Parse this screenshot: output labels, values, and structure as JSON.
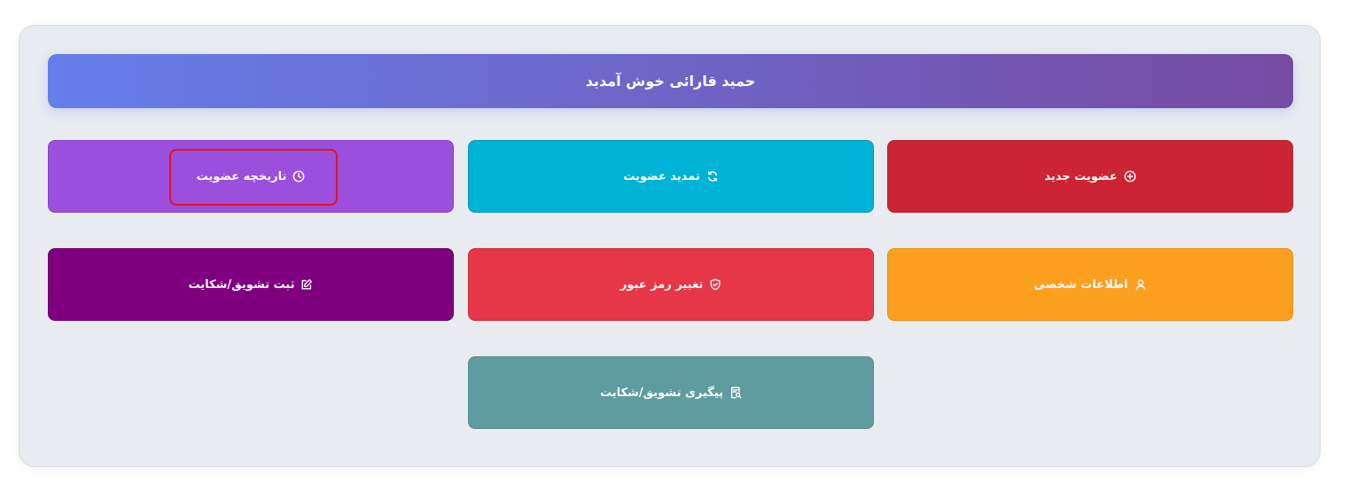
{
  "welcome": {
    "title": "حمید قارائی خوش آمدید"
  },
  "tiles": [
    {
      "label": "عضویت جدید",
      "icon": "plus-circle-icon",
      "color": "#cc2434",
      "border": "#b71f2e"
    },
    {
      "label": "تمدید عضویت",
      "icon": "refresh-icon",
      "color": "#00b2d6",
      "border": "#0098b8"
    },
    {
      "label": "تاریخچه عضویت",
      "icon": "clock-icon",
      "color": "#9b4fdd",
      "border": "#8a3fcc"
    },
    {
      "label": "اطلاعات شخصی",
      "icon": "user-icon",
      "color": "#fd9f1e",
      "border": "#e88e12"
    },
    {
      "label": "تغییر رمز عبور",
      "icon": "shield-check-icon",
      "color": "#e53747",
      "border": "#cf2c3b"
    },
    {
      "label": "ثبت تشویق/شکایت",
      "icon": "edit-icon",
      "color": "#7f007f",
      "border": "#6b006b"
    },
    {
      "label": "پیگیری تشویق/شکایت",
      "icon": "document-search-icon",
      "color": "#5f9c9f",
      "border": "#558d90"
    }
  ],
  "banner_gradient": [
    "#667eea",
    "#764ba2"
  ],
  "panel_background": "#e8ebef",
  "highlight_color": "#e4121b"
}
